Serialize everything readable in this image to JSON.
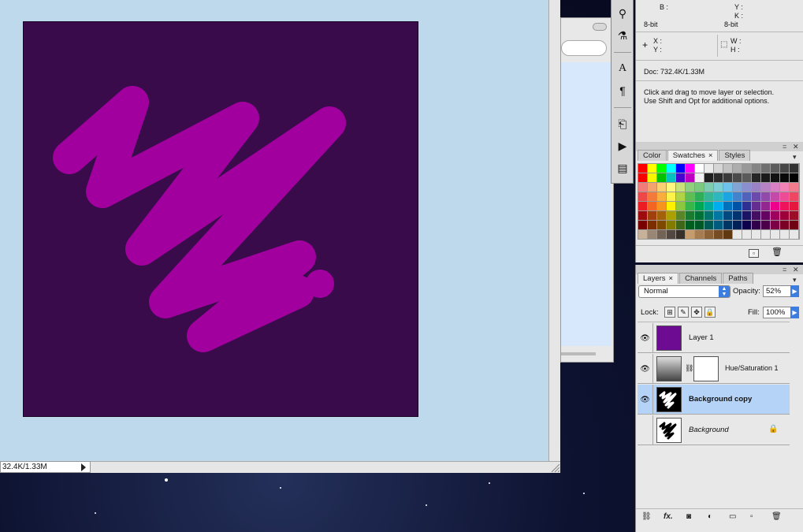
{
  "document": {
    "status_text": "32.4K/1.33M"
  },
  "info_panel": {
    "b_label": "B :",
    "y_label": "Y :",
    "k_label": "K :",
    "bit_left": "8-bit",
    "bit_right": "8-bit",
    "x_label": "X :",
    "ycoord_label": "Y :",
    "w_label": "W :",
    "h_label": "H :",
    "doc_size": "Doc: 732.4K/1.33M",
    "hint_line1": "Click and drag to move layer or selection.",
    "hint_line2": "Use Shift and Opt for additional options."
  },
  "swatches_panel": {
    "tabs": [
      {
        "label": "Color"
      },
      {
        "label": "Swatches"
      },
      {
        "label": "Styles"
      }
    ],
    "close_glyph": "×",
    "swatch_rows": [
      [
        "#ff0000",
        "#ffff00",
        "#00ff00",
        "#00ffff",
        "#0000ff",
        "#ff00ff",
        "#ffffff",
        "#ebebeb",
        "#d6d6d6",
        "#c2c2c2",
        "#adadad",
        "#999999",
        "#858585",
        "#707070",
        "#5c5c5c",
        "#474747",
        "#333333"
      ],
      [
        "#f70000",
        "#f7f700",
        "#00c000",
        "#00c0c0",
        "#4a00d0",
        "#c000c0",
        "#f0f0f0",
        "#1f1f1f",
        "#2c2c2c",
        "#3a3a3a",
        "#4a4a4a",
        "#5a5a5a",
        "#262626",
        "#1a1a1a",
        "#111111",
        "#080808",
        "#000000"
      ],
      [
        "#f27c7c",
        "#f5a36e",
        "#fbcf73",
        "#fff77f",
        "#c9e27a",
        "#8fd17f",
        "#7cca7e",
        "#7fcdb0",
        "#7dcfd3",
        "#6fc3ea",
        "#83a5d6",
        "#8b8fd0",
        "#9a82c4",
        "#b782c3",
        "#d97fc4",
        "#f182b5",
        "#f27c8d"
      ],
      [
        "#ee4747",
        "#f37a3a",
        "#faae3e",
        "#fff34b",
        "#afd446",
        "#5ebd54",
        "#2fae58",
        "#37b597",
        "#2fb7bf",
        "#1ba5e2",
        "#4383cc",
        "#5162bb",
        "#6b4aab",
        "#904aa9",
        "#c34aa8",
        "#ed4b95",
        "#ee4764"
      ],
      [
        "#ec1c24",
        "#f26522",
        "#f7941d",
        "#fff200",
        "#8dc63f",
        "#39b54a",
        "#00a651",
        "#00a99d",
        "#00aeef",
        "#0072bc",
        "#0054a6",
        "#2e3192",
        "#662d91",
        "#92278f",
        "#ec008c",
        "#ed145b",
        "#e5173f"
      ],
      [
        "#9e0b0f",
        "#a0410d",
        "#a36209",
        "#aba000",
        "#598527",
        "#197b30",
        "#007236",
        "#00746b",
        "#0076a3",
        "#004a80",
        "#003471",
        "#1b1464",
        "#440e62",
        "#630460",
        "#9e005d",
        "#9e0039",
        "#9b0c26"
      ],
      [
        "#790000",
        "#7b2e00",
        "#7d4900",
        "#827b00",
        "#406618",
        "#005e20",
        "#005826",
        "#005952",
        "#005b7f",
        "#003663",
        "#002157",
        "#0d004c",
        "#32004b",
        "#4b0049",
        "#7b0046",
        "#7a0026",
        "#6f0313"
      ],
      [
        "#c7b299",
        "#998675",
        "#736357",
        "#534741",
        "#37302a",
        "#c69c6d",
        "#a67c52",
        "#8c6239",
        "#754c24",
        "#603913",
        "",
        "",
        "",
        "",
        "",
        "",
        ""
      ]
    ]
  },
  "layers_panel": {
    "tabs": [
      {
        "label": "Layers"
      },
      {
        "label": "Channels"
      },
      {
        "label": "Paths"
      }
    ],
    "close_glyph": "×",
    "blend_mode": "Normal",
    "opacity_label": "Opacity:",
    "opacity_value": "52%",
    "lock_label": "Lock:",
    "fill_label": "Fill:",
    "fill_value": "100%",
    "layers": [
      {
        "name": "Layer 1",
        "visible": true,
        "selected": false,
        "thumb_color": "#6e0b93"
      },
      {
        "name": "Hue/Saturation 1",
        "visible": true,
        "selected": false
      },
      {
        "name": "Background copy",
        "visible": true,
        "selected": true
      },
      {
        "name": "Background",
        "visible": false,
        "selected": false,
        "locked": true
      }
    ]
  },
  "colors": {
    "canvas_bg": "#bfd9ec",
    "art_bg": "#390b4b",
    "scribble": "#a1009e",
    "selection": "#b5d3f6"
  },
  "icons": [
    "eye-icon",
    "lock-icon",
    "link-icon",
    "fx-icon",
    "mask-icon",
    "adjustment-icon",
    "folder-icon",
    "new-layer-icon",
    "trash-icon",
    "tool-icons"
  ]
}
